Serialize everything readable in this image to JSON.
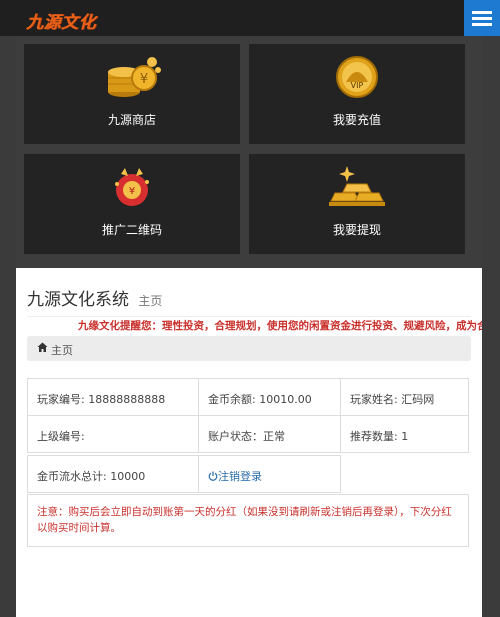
{
  "brand": {
    "logo_text": "九源文化"
  },
  "nav": {
    "menu_icon": "hamburger-menu-icon"
  },
  "tiles": [
    {
      "label": "九源商店",
      "icon": "coins-icon"
    },
    {
      "label": "我要充值",
      "icon": "vip-ingot-icon"
    },
    {
      "label": "推广二维码",
      "icon": "lucky-cat-icon"
    },
    {
      "label": "我要提现",
      "icon": "gold-bars-icon"
    }
  ],
  "page": {
    "title": "九源文化系统",
    "subtitle": "主页",
    "notice": "九缘文化提醒您：理性投资，合理规划，使用您的闲置资金进行投资、规避风险，成为合",
    "breadcrumb": "主页",
    "breadcrumb_icon": "home-icon"
  },
  "account": {
    "player_id": "玩家编号: 18888888888",
    "coin_balance": "金币余额: 10010.00",
    "player_name": "玩家姓名: 汇码网",
    "superior_id": "上级编号:",
    "account_status": "账户状态：正常",
    "referral_count": "推荐数量: 1",
    "coin_flow_total": "金币流水总计: 10000",
    "logout_label": "注销登录",
    "logout_icon": "power-icon"
  },
  "notice_box": {
    "text": "注意：购买后会立即自动到账第一天的分红（如果没到请刷新或注销后再登录），下次分红以购买时间计算。"
  },
  "colors": {
    "accent_blue": "#1e7ad1",
    "brand_orange": "#e8621a",
    "warning_red": "#c9302c"
  }
}
